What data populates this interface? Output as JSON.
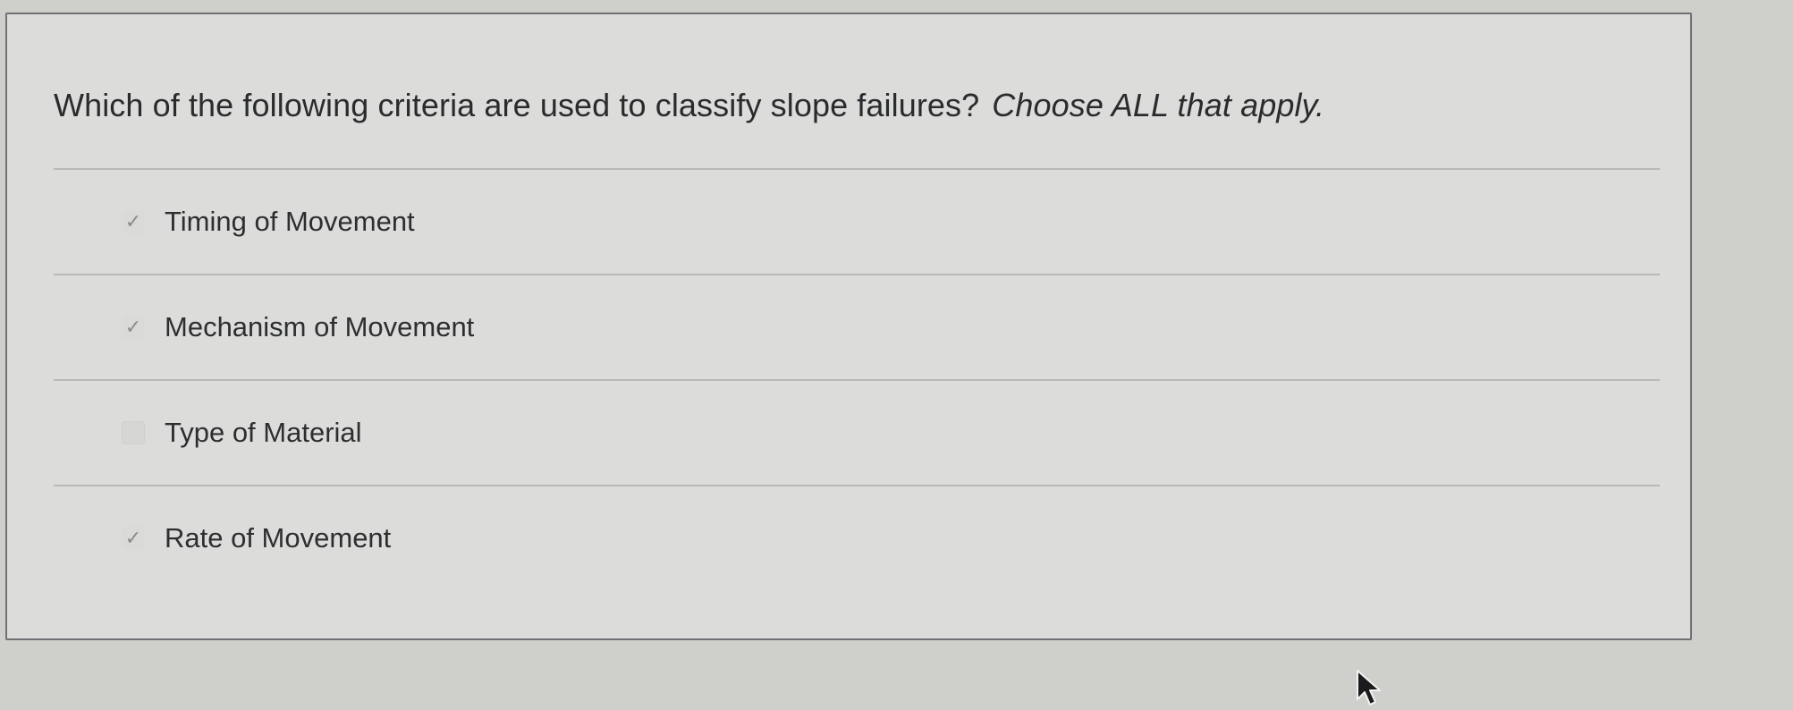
{
  "question": {
    "prompt": "Which of the following criteria are used to classify slope failures?",
    "instruction": "Choose ALL that apply."
  },
  "options": [
    {
      "label": "Timing of Movement",
      "checked": true,
      "icon": "checkmark-icon"
    },
    {
      "label": "Mechanism of Movement",
      "checked": true,
      "icon": "checkmark-icon"
    },
    {
      "label": "Type of Material",
      "checked": false,
      "icon": ""
    },
    {
      "label": "Rate of Movement",
      "checked": true,
      "icon": "checkmark-icon"
    }
  ],
  "colors": {
    "page_background": "#cfd0cc",
    "card_background": "#dcdddb",
    "card_border": "#6f7073",
    "text": "#2b2c2e",
    "divider": "#b9bab7",
    "checkmark": "#8b8d8c"
  }
}
